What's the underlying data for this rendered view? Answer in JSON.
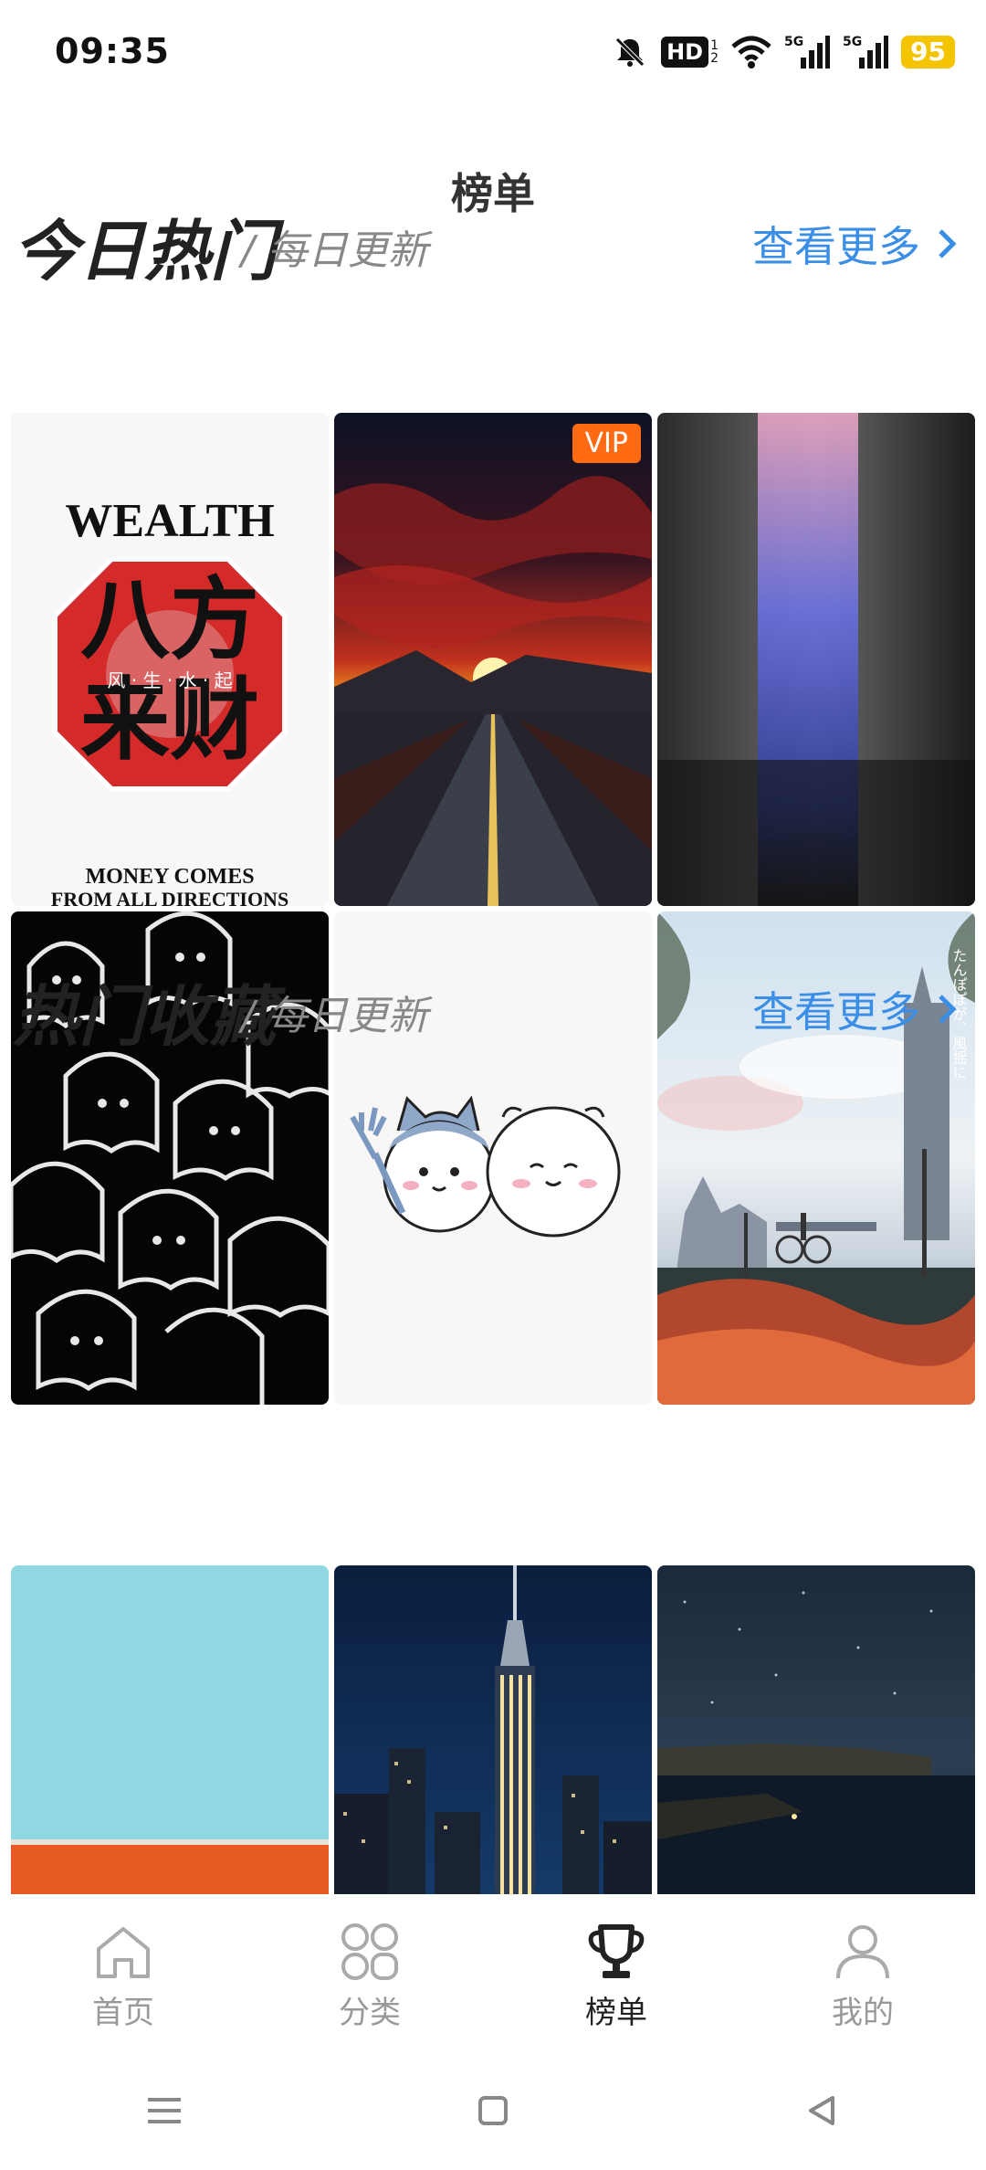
{
  "status_bar": {
    "time": "09:35",
    "hd_label": "HD",
    "hd_sim": "1",
    "hd_sim2": "2",
    "net1": "5G",
    "net2": "5G",
    "battery": "95"
  },
  "page": {
    "title": "榜单"
  },
  "sections": [
    {
      "title": "今日热门",
      "subtitle": "/ 每日更新",
      "more": "查看更多"
    },
    {
      "title": "热门收藏",
      "subtitle": "/ 每日更新",
      "more": "查看更多"
    }
  ],
  "tiles": {
    "wealth": {
      "top": "WEALTH",
      "big1": "八方",
      "big2": "来财",
      "mid": "风 · 生 · 水 · 起",
      "bottom1": "MONEY COMES",
      "bottom2": "FROM ALL DIRECTIONS"
    },
    "sunset": {
      "badge": "VIP"
    },
    "city": {
      "caption": "たんぽぽが、風揺に"
    }
  },
  "bottom_nav": [
    {
      "label": "首页",
      "icon": "home-icon"
    },
    {
      "label": "分类",
      "icon": "category-icon"
    },
    {
      "label": "榜单",
      "icon": "trophy-icon"
    },
    {
      "label": "我的",
      "icon": "profile-icon"
    }
  ],
  "colors": {
    "accent": "#3b8ee6",
    "vip": "#ff6a13",
    "battery": "#f5c400"
  }
}
